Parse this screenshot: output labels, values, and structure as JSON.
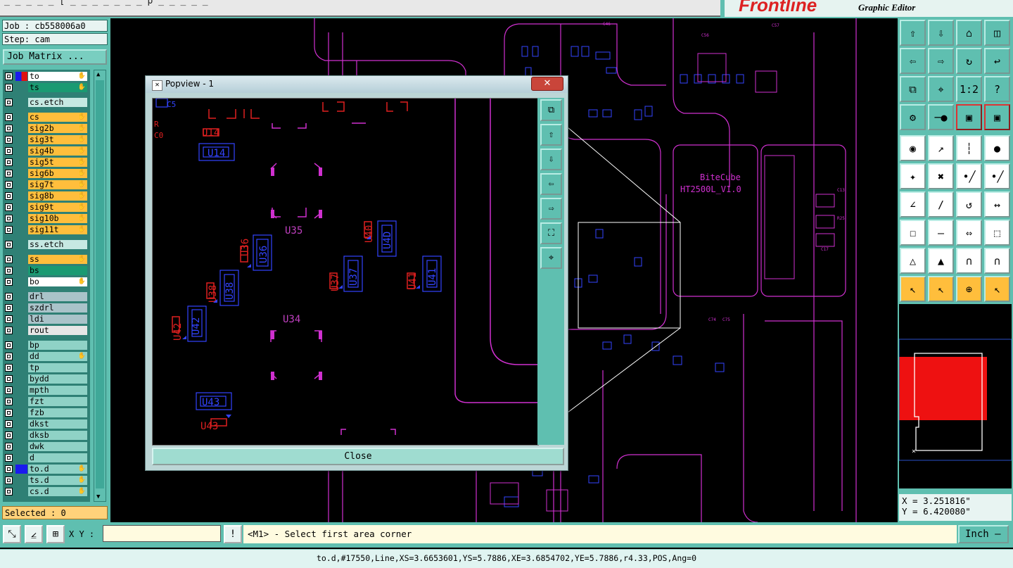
{
  "app": {
    "brand": "Frontline",
    "subtitle": "Graphic Editor",
    "title_fragment": "_  _ _   _ _    [ _    _   _ _ _     _ _ p _ _ _   _ _"
  },
  "job": {
    "job_label": "Job : cb558006a0",
    "step_label": "Step: cam",
    "matrix_button": "Job Matrix ..."
  },
  "layers": [
    {
      "name": "to",
      "bg": "#ffffff",
      "swatch": "#1a1aee",
      "swatch2": "#e01010",
      "hand": "✋"
    },
    {
      "name": "ts",
      "bg": "#1a9a72",
      "swatch": "",
      "hand": "✋"
    },
    {
      "name": "cs.etch",
      "bg": "#c6e8e2",
      "swatch": "",
      "hand": "",
      "gap": true
    },
    {
      "name": "cs",
      "bg": "#ffbe3c",
      "swatch": "",
      "hand": "✋",
      "gap": true
    },
    {
      "name": "sig2b",
      "bg": "#ffbe3c",
      "swatch": "",
      "hand": "✋"
    },
    {
      "name": "sig3t",
      "bg": "#ffbe3c",
      "swatch": "",
      "hand": "✋"
    },
    {
      "name": "sig4b",
      "bg": "#ffbe3c",
      "swatch": "",
      "hand": "✋"
    },
    {
      "name": "sig5t",
      "bg": "#ffbe3c",
      "swatch": "",
      "hand": "✋"
    },
    {
      "name": "sig6b",
      "bg": "#ffbe3c",
      "swatch": "",
      "hand": "✋"
    },
    {
      "name": "sig7t",
      "bg": "#ffbe3c",
      "swatch": "",
      "hand": "✋"
    },
    {
      "name": "sig8b",
      "bg": "#ffbe3c",
      "swatch": "",
      "hand": "✋"
    },
    {
      "name": "sig9t",
      "bg": "#ffbe3c",
      "swatch": "",
      "hand": "✋"
    },
    {
      "name": "sig10b",
      "bg": "#ffbe3c",
      "swatch": "",
      "hand": "✋"
    },
    {
      "name": "sig11t",
      "bg": "#ffbe3c",
      "swatch": "",
      "hand": "✋"
    },
    {
      "name": "ss.etch",
      "bg": "#c6e8e2",
      "swatch": "",
      "hand": "",
      "gap": true
    },
    {
      "name": "ss",
      "bg": "#ffbe3c",
      "swatch": "",
      "hand": "✋",
      "gap": true
    },
    {
      "name": "bs",
      "bg": "#1a9a72",
      "swatch": "",
      "hand": ""
    },
    {
      "name": "bo",
      "bg": "#ffffff",
      "swatch": "",
      "hand": "✋"
    },
    {
      "name": "drl",
      "bg": "#a9c3c9",
      "swatch": "",
      "hand": "",
      "gap": true
    },
    {
      "name": "szdrl",
      "bg": "#a9c3c9",
      "swatch": "",
      "hand": ""
    },
    {
      "name": "ldi",
      "bg": "#a9c3c9",
      "swatch": "",
      "hand": ""
    },
    {
      "name": "rout",
      "bg": "#e6e6e6",
      "swatch": "",
      "hand": ""
    },
    {
      "name": "bp",
      "bg": "#8fd2c6",
      "swatch": "",
      "hand": "",
      "gap": true
    },
    {
      "name": "dd",
      "bg": "#8fd2c6",
      "swatch": "",
      "hand": "✋"
    },
    {
      "name": "tp",
      "bg": "#8fd2c6",
      "swatch": "",
      "hand": ""
    },
    {
      "name": "bydd",
      "bg": "#8fd2c6",
      "swatch": "",
      "hand": ""
    },
    {
      "name": "mpth",
      "bg": "#8fd2c6",
      "swatch": "",
      "hand": ""
    },
    {
      "name": "fzt",
      "bg": "#8fd2c6",
      "swatch": "",
      "hand": ""
    },
    {
      "name": "fzb",
      "bg": "#8fd2c6",
      "swatch": "",
      "hand": ""
    },
    {
      "name": "dkst",
      "bg": "#8fd2c6",
      "swatch": "",
      "hand": ""
    },
    {
      "name": "dksb",
      "bg": "#8fd2c6",
      "swatch": "",
      "hand": ""
    },
    {
      "name": "dwk",
      "bg": "#8fd2c6",
      "swatch": "",
      "hand": ""
    },
    {
      "name": "d",
      "bg": "#8fd2c6",
      "swatch": "",
      "hand": ""
    },
    {
      "name": "to.d",
      "bg": "#8fd2c6",
      "swatch": "#1a1aee",
      "hand": "✋"
    },
    {
      "name": "ts.d",
      "bg": "#8fd2c6",
      "swatch": "",
      "hand": "✋"
    },
    {
      "name": "cs.d",
      "bg": "#8fd2c6",
      "swatch": "",
      "hand": "✋"
    }
  ],
  "selected": "Selected : 0",
  "board_text": {
    "line1": "BiteCube",
    "line2": "HT2500L_V1.0"
  },
  "popview": {
    "title": "Popview - 1",
    "close_x": "✕",
    "close_button": "Close",
    "labels": {
      "u14a": "U14",
      "u14b": "U14",
      "u35": "U35",
      "u36a": "U36",
      "u36b": "U36",
      "u40a": "U40",
      "u40b": "U4D",
      "u38a": "U38",
      "u38b": "U38",
      "u37a": "U37",
      "u37b": "U37",
      "u41a": "U41",
      "u41b": "U41",
      "u34": "U34",
      "u42a": "U42",
      "u42b": "U42",
      "u43a": "U43",
      "u43b": "U43",
      "c5": "C5",
      "c0": "C0",
      "r": "R"
    }
  },
  "toolbar_icons": [
    "move-up-icon",
    "move-down-icon",
    "home-icon",
    "split-window-icon",
    "move-left-icon",
    "move-right-icon",
    "loop-icon",
    "route-icon",
    "fit-all-icon",
    "zoom-center-icon",
    "scale-1-2-icon",
    "help-icon",
    "probe-icon",
    "measure-icon",
    "layer-compare-icon",
    "layer-step-icon",
    "drop-pad-icon",
    "diagonal-select-icon",
    "ruler-icon",
    "pad-icon",
    "net-icon",
    "cut-icon",
    "add-line-icon",
    "add-line-2-icon",
    "angle-icon",
    "slant-icon",
    "arc-icon",
    "flip-icon",
    "box-select-icon",
    "line-icon",
    "distance-icon",
    "shape-icon",
    "triangle-icon",
    "triangle-arrow-icon",
    "arch-icon",
    "arch-line-icon",
    "pointer-icon",
    "select-box-icon",
    "select-target-icon",
    "step-select-icon"
  ],
  "toolbar_glyphs": [
    "⇧",
    "⇩",
    "⌂",
    "◫",
    "⇦",
    "⇨",
    "↻",
    "↩",
    "⧉",
    "⌖",
    "1:2",
    "?",
    "⚙",
    "─●",
    "▣",
    "▣",
    "◉",
    "↗",
    "┆",
    "●",
    "✦",
    "✖",
    "•╱",
    "•╱",
    "∠",
    "∕",
    "↺",
    "↔",
    "☐",
    "—",
    "⇔",
    "⬚",
    "△",
    "▲",
    "∩",
    "∩",
    "↖",
    "↖",
    "⊕",
    "↖"
  ],
  "coords": {
    "x": "X = 3.251816\"",
    "y": "Y = 6.420080\""
  },
  "bottom": {
    "xy_label": "X Y :",
    "xy_value": "",
    "prompt": "<M1> - Select first area corner",
    "unit": "Inch —",
    "info_button": "!"
  },
  "status": "to.d,#17550,Line,XS=3.6653601,YS=5.7886,XE=3.6854702,YE=5.7886,r4.33,POS,Ang=0"
}
